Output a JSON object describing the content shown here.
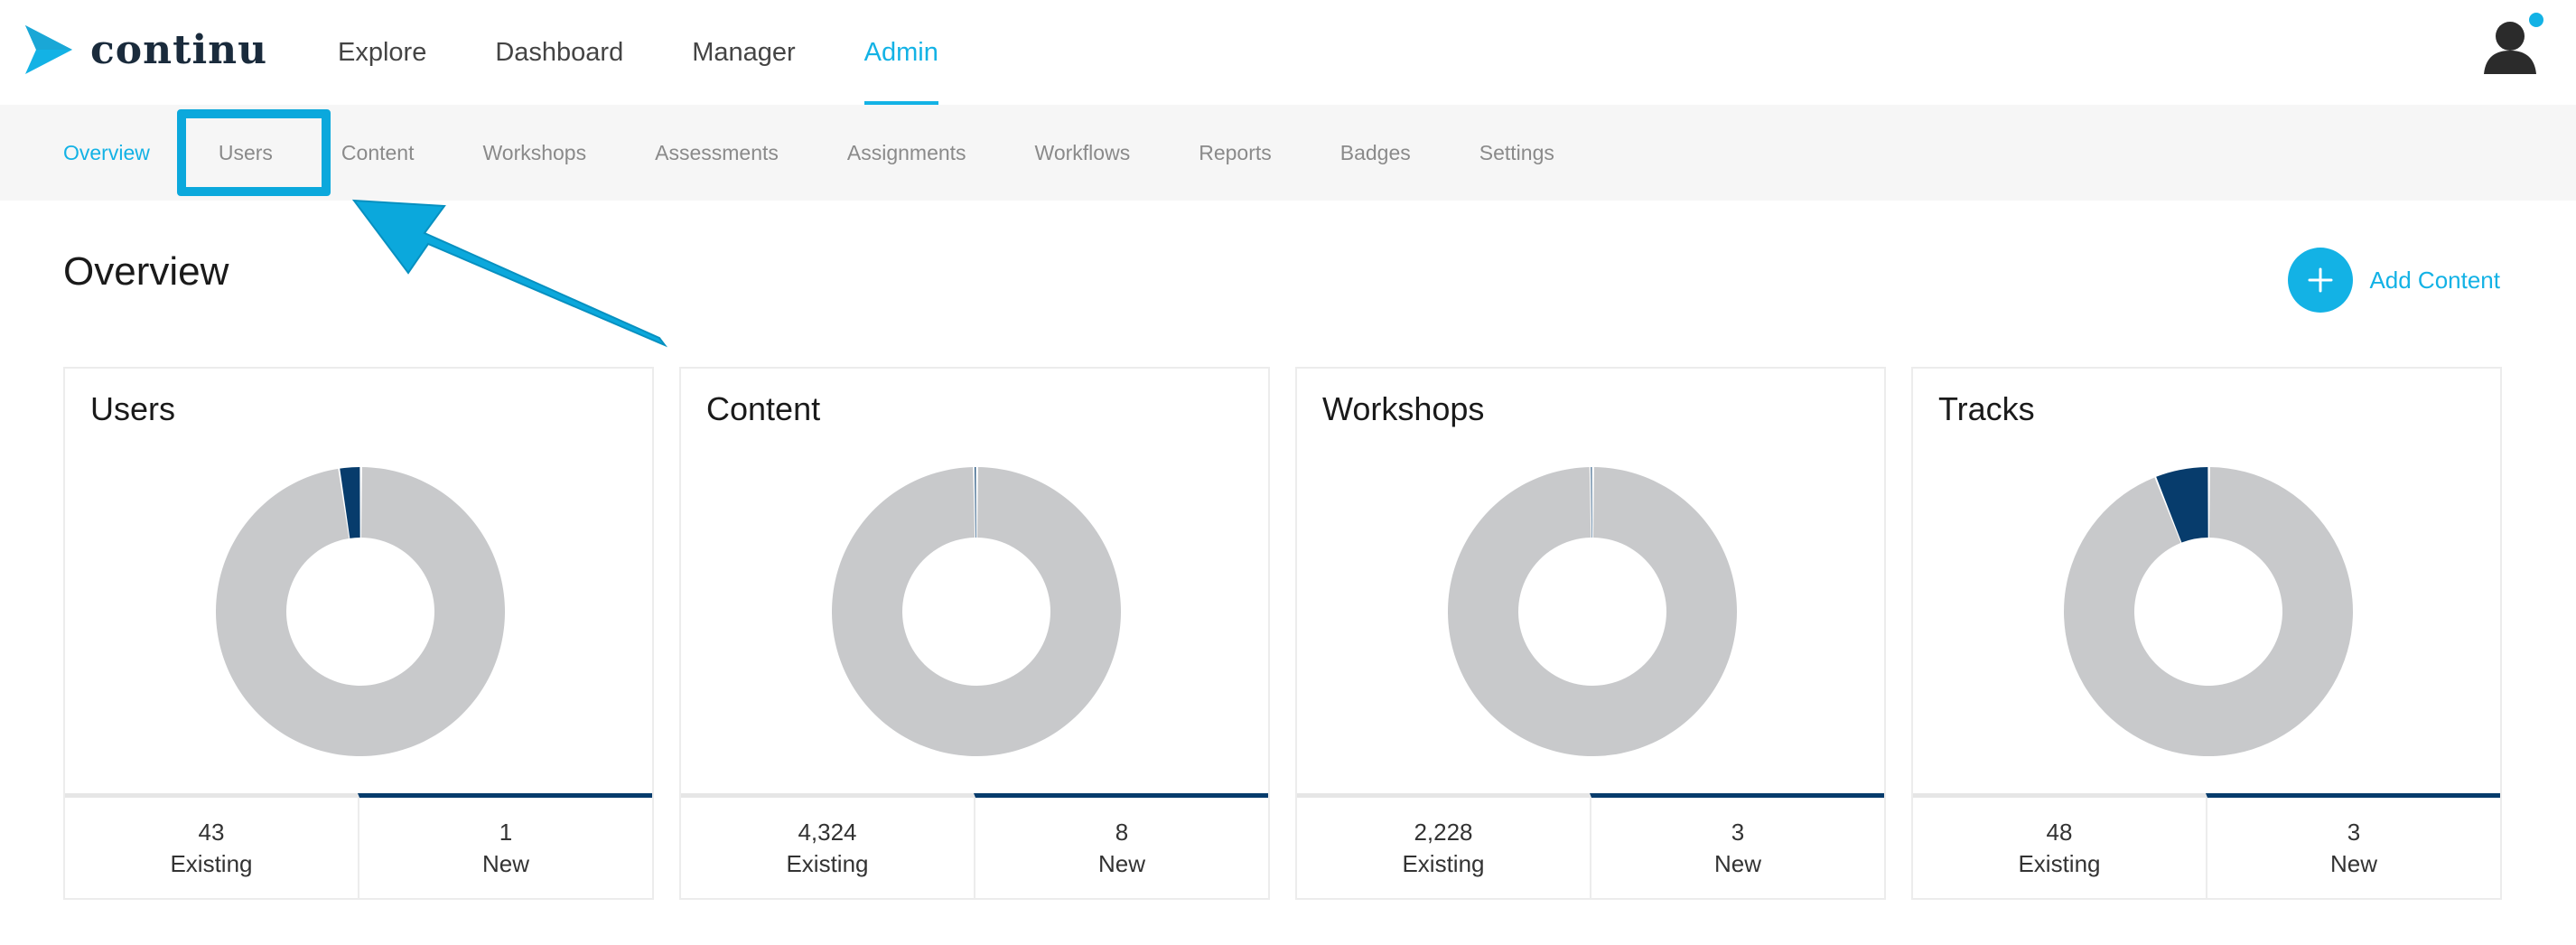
{
  "brand": {
    "name": "continu",
    "accent": "#13b2e5",
    "dark": "#073c6c"
  },
  "main_nav": [
    {
      "label": "Explore",
      "active": false
    },
    {
      "label": "Dashboard",
      "active": false
    },
    {
      "label": "Manager",
      "active": false
    },
    {
      "label": "Admin",
      "active": true
    }
  ],
  "sub_nav": [
    {
      "label": "Overview",
      "active": true
    },
    {
      "label": "Users",
      "active": false
    },
    {
      "label": "Content",
      "active": false
    },
    {
      "label": "Workshops",
      "active": false
    },
    {
      "label": "Assessments",
      "active": false
    },
    {
      "label": "Assignments",
      "active": false
    },
    {
      "label": "Workflows",
      "active": false
    },
    {
      "label": "Reports",
      "active": false
    },
    {
      "label": "Badges",
      "active": false
    },
    {
      "label": "Settings",
      "active": false
    }
  ],
  "page": {
    "title": "Overview",
    "add_content_label": "Add Content"
  },
  "cards": [
    {
      "title": "Users",
      "existing": "43",
      "existing_label": "Existing",
      "new": "1",
      "new_label": "New"
    },
    {
      "title": "Content",
      "existing": "4,324",
      "existing_label": "Existing",
      "new": "8",
      "new_label": "New"
    },
    {
      "title": "Workshops",
      "existing": "2,228",
      "existing_label": "Existing",
      "new": "3",
      "new_label": "New"
    },
    {
      "title": "Tracks",
      "existing": "48",
      "existing_label": "Existing",
      "new": "3",
      "new_label": "New"
    }
  ],
  "chart_data": [
    {
      "type": "pie",
      "categories": [
        "Existing",
        "New"
      ],
      "values": [
        43,
        1
      ],
      "colors": [
        "#c8c9cb",
        "#073c6c"
      ]
    },
    {
      "type": "pie",
      "categories": [
        "Existing",
        "New"
      ],
      "values": [
        4324,
        8
      ],
      "colors": [
        "#c8c9cb",
        "#073c6c"
      ]
    },
    {
      "type": "pie",
      "categories": [
        "Existing",
        "New"
      ],
      "values": [
        2228,
        3
      ],
      "colors": [
        "#c8c9cb",
        "#073c6c"
      ]
    },
    {
      "type": "pie",
      "categories": [
        "Existing",
        "New"
      ],
      "values": [
        48,
        3
      ],
      "colors": [
        "#c8c9cb",
        "#073c6c"
      ]
    }
  ],
  "icons": {
    "logo": "arrow-logo-icon",
    "avatar": "user-avatar-icon",
    "add": "plus-icon",
    "annotation": "pointer-arrow-icon"
  }
}
